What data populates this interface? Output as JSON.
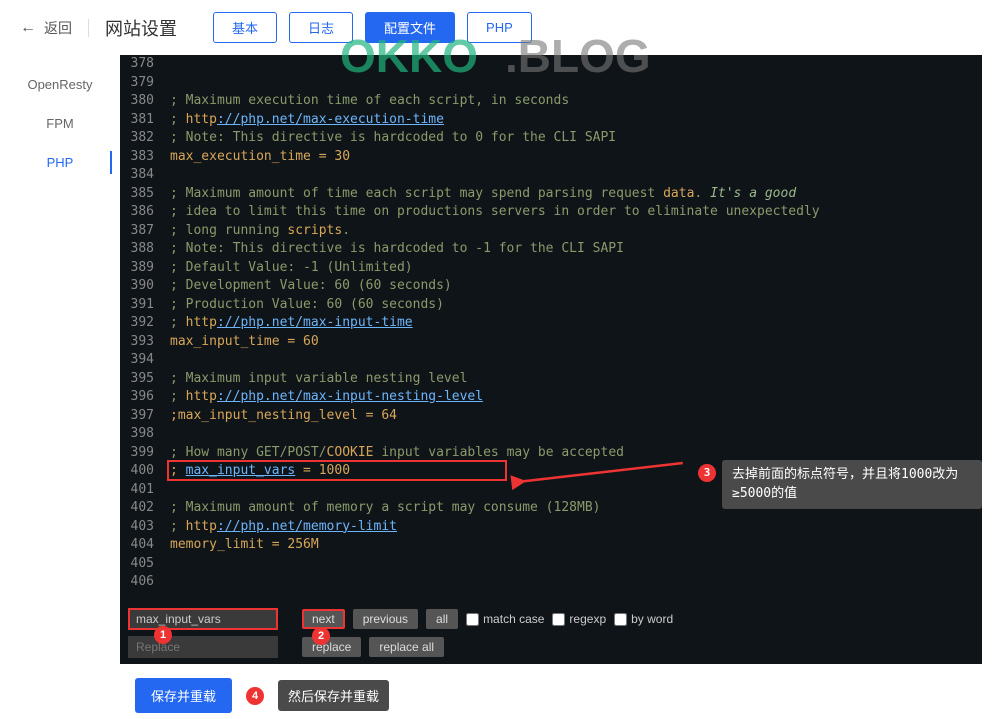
{
  "header": {
    "back_label": "返回",
    "title": "网站设置",
    "tabs": [
      {
        "label": "基本"
      },
      {
        "label": "日志"
      },
      {
        "label": "配置文件",
        "active": true
      },
      {
        "label": "PHP"
      }
    ]
  },
  "sidebar": {
    "items": [
      {
        "label": "OpenResty"
      },
      {
        "label": "FPM"
      },
      {
        "label": "PHP",
        "active": true
      }
    ]
  },
  "watermark_text": "OKKO.BLOG",
  "editor": {
    "first_line_no": 378,
    "lines": [
      {
        "n": 378,
        "segs": []
      },
      {
        "n": 379,
        "segs": [
          {
            "t": "    ",
            "c": ""
          }
        ]
      },
      {
        "n": 380,
        "segs": [
          {
            "t": "; Maximum execution time of each script, in seconds",
            "c": "c-comment"
          }
        ]
      },
      {
        "n": 381,
        "segs": [
          {
            "t": "; ",
            "c": "c-comment"
          },
          {
            "t": "http",
            "c": "c-keyword"
          },
          {
            "t": "://php.net/max-execution-time",
            "c": "c-link"
          }
        ]
      },
      {
        "n": 382,
        "segs": [
          {
            "t": "; Note: This directive is hardcoded to 0 for the CLI SAPI",
            "c": "c-comment"
          }
        ]
      },
      {
        "n": 383,
        "segs": [
          {
            "t": "max_execution_time ",
            "c": "c-string"
          },
          {
            "t": "=",
            "c": "c-op"
          },
          {
            "t": " 30",
            "c": "c-string"
          }
        ]
      },
      {
        "n": 384,
        "segs": []
      },
      {
        "n": 385,
        "segs": [
          {
            "t": "; Maximum amount of time each script may spend parsing request ",
            "c": "c-comment"
          },
          {
            "t": "data",
            "c": "c-keyword"
          },
          {
            "t": ". ",
            "c": "c-comment"
          },
          {
            "t": "It's a good",
            "c": "c-italic"
          }
        ]
      },
      {
        "n": 386,
        "segs": [
          {
            "t": "; idea to limit this time on productions servers in order to eliminate unexpectedly",
            "c": "c-comment"
          }
        ]
      },
      {
        "n": 387,
        "segs": [
          {
            "t": "; long running ",
            "c": "c-comment"
          },
          {
            "t": "scripts",
            "c": "c-keyword"
          },
          {
            "t": ".",
            "c": "c-comment"
          }
        ]
      },
      {
        "n": 388,
        "segs": [
          {
            "t": "; Note: This directive is hardcoded to -1 for the CLI SAPI",
            "c": "c-comment"
          }
        ]
      },
      {
        "n": 389,
        "segs": [
          {
            "t": "; Default Value: -1 (Unlimited)",
            "c": "c-comment"
          }
        ]
      },
      {
        "n": 390,
        "segs": [
          {
            "t": "; Development Value: 60 (60 seconds)",
            "c": "c-comment"
          }
        ]
      },
      {
        "n": 391,
        "segs": [
          {
            "t": "; Production Value: 60 (60 seconds)",
            "c": "c-comment"
          }
        ]
      },
      {
        "n": 392,
        "segs": [
          {
            "t": "; ",
            "c": "c-comment"
          },
          {
            "t": "http",
            "c": "c-keyword"
          },
          {
            "t": "://php.net/max-input-time",
            "c": "c-link"
          }
        ]
      },
      {
        "n": 393,
        "segs": [
          {
            "t": "max_input_time ",
            "c": "c-string"
          },
          {
            "t": "=",
            "c": "c-op"
          },
          {
            "t": " 60",
            "c": "c-string"
          }
        ]
      },
      {
        "n": 394,
        "segs": []
      },
      {
        "n": 395,
        "segs": [
          {
            "t": "; Maximum input variable nesting level",
            "c": "c-comment"
          }
        ]
      },
      {
        "n": 396,
        "segs": [
          {
            "t": "; ",
            "c": "c-comment"
          },
          {
            "t": "http",
            "c": "c-keyword"
          },
          {
            "t": "://php.net/max-input-nesting-level",
            "c": "c-link"
          }
        ]
      },
      {
        "n": 397,
        "segs": [
          {
            "t": ";max_input_nesting_level ",
            "c": "c-string"
          },
          {
            "t": "=",
            "c": "c-op"
          },
          {
            "t": " 64",
            "c": "c-string"
          }
        ]
      },
      {
        "n": 398,
        "segs": []
      },
      {
        "n": 399,
        "segs": [
          {
            "t": "; How many GET/POST/",
            "c": "c-comment"
          },
          {
            "t": "COOKIE",
            "c": "c-keyword"
          },
          {
            "t": " input variables may be accepted",
            "c": "c-comment"
          }
        ]
      },
      {
        "n": 400,
        "segs": [
          {
            "t": "; ",
            "c": "c-punct"
          },
          {
            "t": "max_input_vars",
            "c": "c-link"
          },
          {
            "t": " = 1000",
            "c": "c-string"
          }
        ]
      },
      {
        "n": 401,
        "segs": []
      },
      {
        "n": 402,
        "segs": [
          {
            "t": "; Maximum amount of memory a script may consume (128MB)",
            "c": "c-comment"
          }
        ]
      },
      {
        "n": 403,
        "segs": [
          {
            "t": "; ",
            "c": "c-comment"
          },
          {
            "t": "http",
            "c": "c-keyword"
          },
          {
            "t": "://php.net/memory-limit",
            "c": "c-link"
          }
        ]
      },
      {
        "n": 404,
        "segs": [
          {
            "t": "memory_limit ",
            "c": "c-string"
          },
          {
            "t": "=",
            "c": "c-op"
          },
          {
            "t": " 256M",
            "c": "c-string"
          }
        ]
      },
      {
        "n": 405,
        "segs": []
      },
      {
        "n": 406,
        "segs": []
      }
    ]
  },
  "search": {
    "search_value": "max_input_vars",
    "replace_placeholder": "Replace",
    "btn_next": "next",
    "btn_previous": "previous",
    "btn_all": "all",
    "btn_replace": "replace",
    "btn_replace_all": "replace all",
    "chk_match_case": "match case",
    "chk_regexp": "regexp",
    "chk_by_word": "by word"
  },
  "annotations": {
    "circle1": "1",
    "circle2": "2",
    "circle3": "3",
    "circle4": "4",
    "tooltip3": "去掉前面的标点符号，并且将1000改为≥5000的值",
    "tooltip4": "然后保存并重载"
  },
  "actions": {
    "save_label": "保存并重载"
  }
}
